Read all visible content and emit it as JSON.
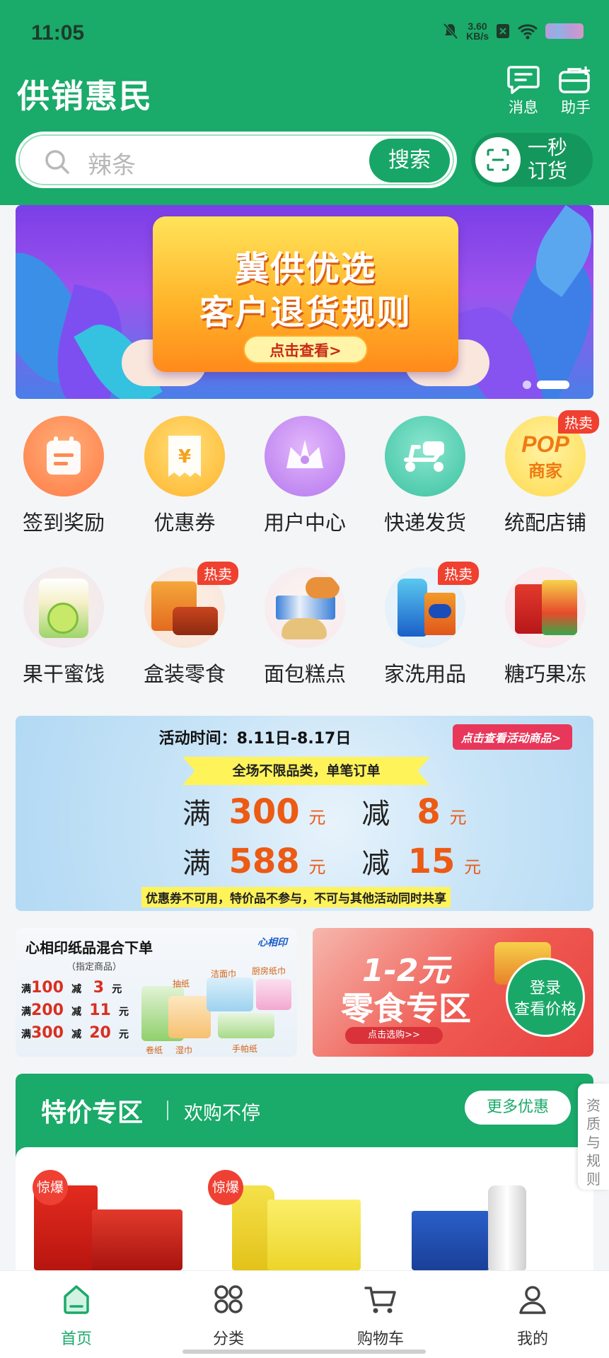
{
  "status_bar": {
    "time": "11:05",
    "speed_value": "3.60",
    "speed_unit": "KB/s"
  },
  "header": {
    "title": "供销惠民",
    "messages_label": "消息",
    "assistant_label": "助手"
  },
  "search": {
    "placeholder": "辣条",
    "button_label": "搜索"
  },
  "quick_order": {
    "label_line1": "一秒",
    "label_line2": "订货"
  },
  "banner": {
    "line1": "冀供优选",
    "line2": "客户退货规则",
    "button_label": "点击查看>",
    "page_count": 2,
    "active_page": 2
  },
  "grid_row1": [
    {
      "label": "签到奖励",
      "icon": "calendar-icon",
      "hot": false
    },
    {
      "label": "优惠券",
      "icon": "coupon-icon",
      "hot": false
    },
    {
      "label": "用户中心",
      "icon": "crown-icon",
      "hot": false
    },
    {
      "label": "快递发货",
      "icon": "scooter-icon",
      "hot": false
    },
    {
      "label": "统配店铺",
      "icon": "pop-merchant-icon",
      "hot": true,
      "icon_text1": "POP",
      "icon_text2": "商家"
    }
  ],
  "grid_row2": [
    {
      "label": "果干蜜饯",
      "icon": "dried-fruit-image",
      "hot": false
    },
    {
      "label": "盒装零食",
      "icon": "boxed-snack-image",
      "hot": true
    },
    {
      "label": "面包糕点",
      "icon": "bread-pastry-image",
      "hot": false
    },
    {
      "label": "家洗用品",
      "icon": "detergent-image",
      "hot": true
    },
    {
      "label": "糖巧果冻",
      "icon": "candy-jelly-image",
      "hot": false
    }
  ],
  "hot_tag": "热卖",
  "promo": {
    "time": "活动时间：8.11日-8.17日",
    "tag": "点击查看活动商品>",
    "ribbon": "全场不限品类，单笔订单",
    "man": "满",
    "jian": "减",
    "yuan": "元",
    "tier1_threshold": "300",
    "tier1_discount": "8",
    "tier2_threshold": "588",
    "tier2_discount": "15",
    "note": "优惠券不可用，特价品不参与，不可与其他活动同时共享"
  },
  "paper_card": {
    "title": "心相印纸品混合下单",
    "subtitle": "（指定商品）",
    "brand": "心相印",
    "tiers": [
      {
        "man": "满",
        "threshold": "100",
        "jian": "减",
        "discount": "3",
        "yuan": "元"
      },
      {
        "man": "满",
        "threshold": "200",
        "jian": "减",
        "discount": "11",
        "yuan": "元"
      },
      {
        "man": "满",
        "threshold": "300",
        "jian": "减",
        "discount": "20",
        "yuan": "元"
      }
    ],
    "labels": [
      "抽纸",
      "洁面巾",
      "厨房纸巾",
      "卷纸",
      "湿巾",
      "手帕纸"
    ]
  },
  "snack_card": {
    "line1": "1-2元",
    "line2": "零食专区",
    "button_label": "点击选购>>",
    "login_line1": "登录",
    "login_line2": "查看价格"
  },
  "special": {
    "title": "特价专区",
    "subtitle": "欢购不停",
    "more_label": "更多优惠",
    "badge": "惊爆"
  },
  "side_tab": {
    "label": "资质与规则"
  },
  "bottom_nav": [
    {
      "label": "首页",
      "icon": "home-icon",
      "active": true
    },
    {
      "label": "分类",
      "icon": "category-icon",
      "active": false
    },
    {
      "label": "购物车",
      "icon": "cart-icon",
      "active": false
    },
    {
      "label": "我的",
      "icon": "profile-icon",
      "active": false
    }
  ],
  "colors": {
    "brand_green": "#1aaa6a",
    "hot_red": "#f0402f",
    "promo_orange": "#ec5a14"
  }
}
